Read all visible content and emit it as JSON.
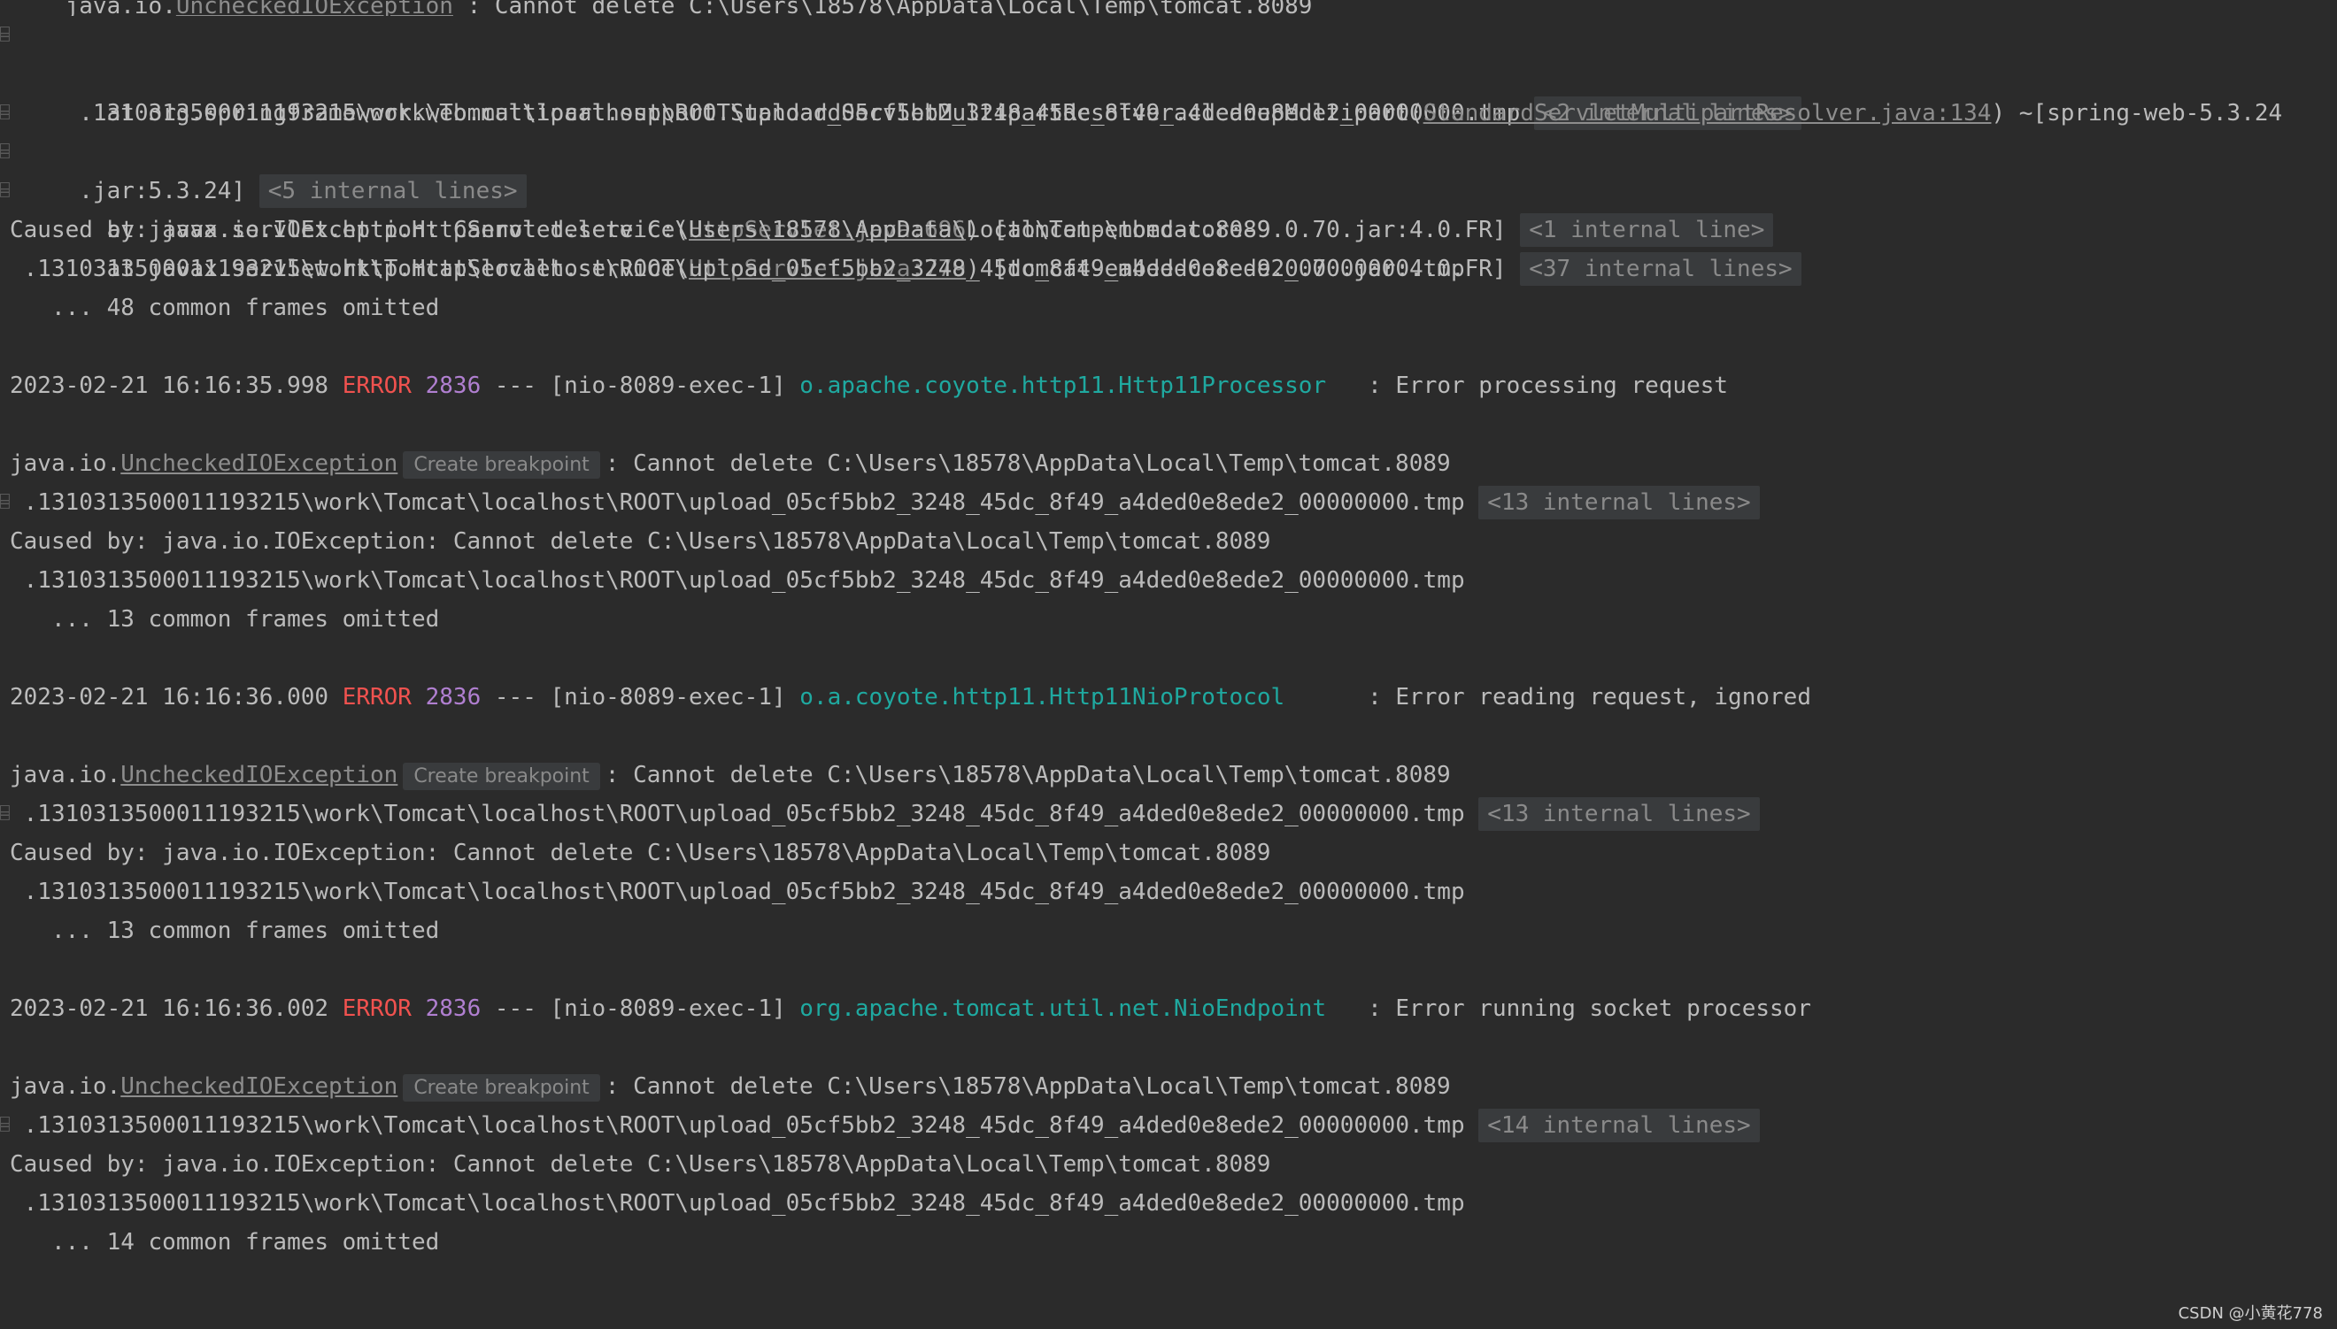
{
  "console": {
    "top_partial": {
      "prefix": "java.io.",
      "exception": "UncheckedIOException",
      "rest": " : Cannot delete C:\\Users\\18578\\AppData\\Local\\Temp\\tomcat.8089"
    },
    "lines": {
      "l1_path": " .1310313500011193215\\work\\Tomcat\\localhost\\ROOT\\upload_05cf5bb2_3248_45dc_8f49_a4ded0e8ede2_00000000.tmp",
      "l1_fold": "<2 internal lines>",
      "l2_prefix": "   at org.springframework.web.multipart.support.StandardServletMultipartResolver.cleanupMultipart(",
      "l2_link": "StandardServletMultipartResolver.java:134",
      "l2_suffix": ") ~[spring-web-5.3.24",
      "l3_text": " .jar:5.3.24]",
      "l3_fold": "<5 internal lines>",
      "l4_prefix": "   at javax.servlet.http.HttpServlet.service(",
      "l4_link": "HttpServlet.java:696",
      "l4_suffix": ") [tomcat-embed-core-9.0.70.jar:4.0.FR]",
      "l4_fold": "<1 internal line>",
      "l5_prefix": "   at javax.servlet.http.HttpServlet.service(",
      "l5_link": "HttpServlet.java:779",
      "l5_suffix": ") [tomcat-embed-core-9.0.70.jar:4.0.FR]",
      "l5_fold": "<37 internal lines>",
      "l6_text": "Caused by: java.io.IOException: Cannot delete C:\\Users\\18578\\AppData\\Local\\Temp\\tomcat.8089",
      "l7_text": " .1310313500011193215\\work\\Tomcat\\localhost\\ROOT\\upload_05cf5bb2_3248_45dc_8f49_a4ded0e8ede2_00000000.tmp",
      "l8_text": "   ... 48 common frames omitted"
    },
    "blocks": [
      {
        "timestamp": "2023-02-21 16:16:35.998 ",
        "level": "ERROR",
        "pid": " 2836",
        "sep": " --- [nio-8089-exec-1] ",
        "logger": "o.apache.coyote.http11.Http11Processor  ",
        "message": " : Error processing request",
        "exc_prefix": "java.io.",
        "exception": "UncheckedIOException",
        "breakpoint": "Create breakpoint",
        "exc_message": ": Cannot delete C:\\Users\\18578\\AppData\\Local\\Temp\\tomcat.8089",
        "path": " .1310313500011193215\\work\\Tomcat\\localhost\\ROOT\\upload_05cf5bb2_3248_45dc_8f49_a4ded0e8ede2_00000000.tmp",
        "fold": "<13 internal lines>",
        "caused_by": "Caused by: java.io.IOException: Cannot delete C:\\Users\\18578\\AppData\\Local\\Temp\\tomcat.8089",
        "caused_path": " .1310313500011193215\\work\\Tomcat\\localhost\\ROOT\\upload_05cf5bb2_3248_45dc_8f49_a4ded0e8ede2_00000000.tmp",
        "omitted": "   ... 13 common frames omitted"
      },
      {
        "timestamp": "2023-02-21 16:16:36.000 ",
        "level": "ERROR",
        "pid": " 2836",
        "sep": " --- [nio-8089-exec-1] ",
        "logger": "o.a.coyote.http11.Http11NioProtocol     ",
        "message": " : Error reading request, ignored",
        "exc_prefix": "java.io.",
        "exception": "UncheckedIOException",
        "breakpoint": "Create breakpoint",
        "exc_message": ": Cannot delete C:\\Users\\18578\\AppData\\Local\\Temp\\tomcat.8089",
        "path": " .1310313500011193215\\work\\Tomcat\\localhost\\ROOT\\upload_05cf5bb2_3248_45dc_8f49_a4ded0e8ede2_00000000.tmp",
        "fold": "<13 internal lines>",
        "caused_by": "Caused by: java.io.IOException: Cannot delete C:\\Users\\18578\\AppData\\Local\\Temp\\tomcat.8089",
        "caused_path": " .1310313500011193215\\work\\Tomcat\\localhost\\ROOT\\upload_05cf5bb2_3248_45dc_8f49_a4ded0e8ede2_00000000.tmp",
        "omitted": "   ... 13 common frames omitted"
      },
      {
        "timestamp": "2023-02-21 16:16:36.002 ",
        "level": "ERROR",
        "pid": " 2836",
        "sep": " --- [nio-8089-exec-1] ",
        "logger": "org.apache.tomcat.util.net.NioEndpoint  ",
        "message": " : Error running socket processor",
        "exc_prefix": "java.io.",
        "exception": "UncheckedIOException",
        "breakpoint": "Create breakpoint",
        "exc_message": ": Cannot delete C:\\Users\\18578\\AppData\\Local\\Temp\\tomcat.8089",
        "path": " .1310313500011193215\\work\\Tomcat\\localhost\\ROOT\\upload_05cf5bb2_3248_45dc_8f49_a4ded0e8ede2_00000000.tmp",
        "fold": "<14 internal lines>",
        "caused_by": "Caused by: java.io.IOException: Cannot delete C:\\Users\\18578\\AppData\\Local\\Temp\\tomcat.8089",
        "caused_path": " .1310313500011193215\\work\\Tomcat\\localhost\\ROOT\\upload_05cf5bb2_3248_45dc_8f49_a4ded0e8ede2_00000000.tmp",
        "omitted": "   ... 14 common frames omitted"
      }
    ]
  },
  "watermark": "CSDN @小黄花778",
  "colors": {
    "background": "#2b2b2b",
    "text": "#bbbbbb",
    "error": "#f0524f",
    "pid": "#b07fd0",
    "logger": "#1fa9a0",
    "link": "#8d8d8d"
  }
}
